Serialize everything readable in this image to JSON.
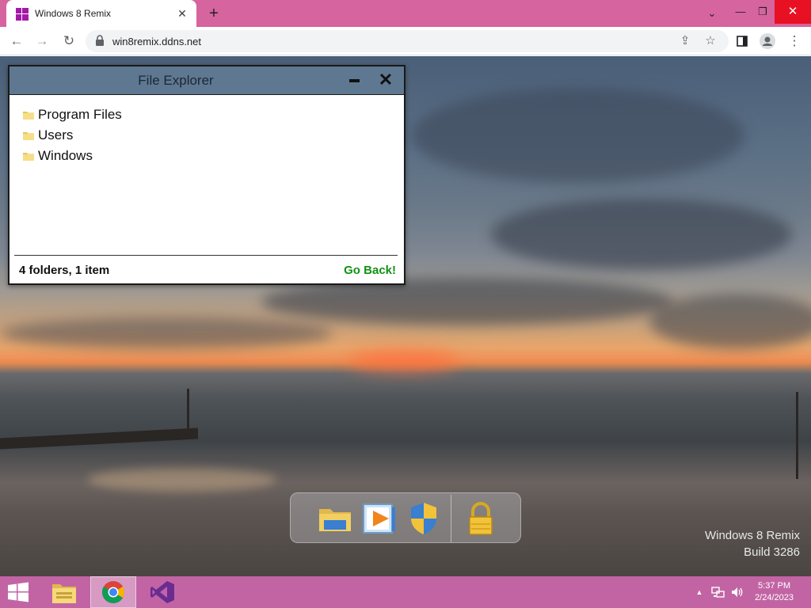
{
  "browser": {
    "tab": {
      "title": "Windows 8 Remix",
      "favicon": "windows-logo-icon",
      "close_icon": "close-icon"
    },
    "new_tab_icon": "plus-icon",
    "window_controls": {
      "tab_search": "chevron-down-icon",
      "minimize": "minimize-icon",
      "restore": "restore-icon",
      "close": "close-icon"
    },
    "toolbar": {
      "back": "back-arrow-icon",
      "forward": "forward-arrow-icon",
      "reload": "reload-icon",
      "url": "win8remix.ddns.net",
      "share": "share-icon",
      "bookmark": "star-icon",
      "side_panel": "side-panel-icon",
      "profile": "profile-icon",
      "menu": "kebab-menu-icon"
    },
    "colors": {
      "titlebar": "#d6649e",
      "close_hover": "#e81123"
    }
  },
  "explorer": {
    "title": "File Explorer",
    "folders": [
      {
        "label": "Program Files"
      },
      {
        "label": "Users"
      },
      {
        "label": "Windows"
      }
    ],
    "status": "4 folders, 1 item",
    "go_back": "Go Back!",
    "colors": {
      "titlebar": "#5f7891",
      "go_back": "#119211"
    }
  },
  "dock": {
    "items": [
      {
        "name": "file-explorer-icon"
      },
      {
        "name": "media-player-icon"
      },
      {
        "name": "security-shield-icon"
      },
      {
        "name": "lock-icon"
      }
    ]
  },
  "watermark": {
    "line1": "Windows 8 Remix",
    "line2": "Build 3286"
  },
  "taskbar": {
    "apps": [
      {
        "name": "file-explorer-icon",
        "active": false
      },
      {
        "name": "chrome-icon",
        "active": true
      },
      {
        "name": "visual-studio-icon",
        "active": false
      }
    ],
    "tray": {
      "show_hidden": "chevron-up-icon",
      "network": "network-icon",
      "volume": "volume-icon"
    },
    "clock": {
      "time": "5:37 PM",
      "date": "2/24/2023"
    },
    "color": "#c264a4"
  }
}
